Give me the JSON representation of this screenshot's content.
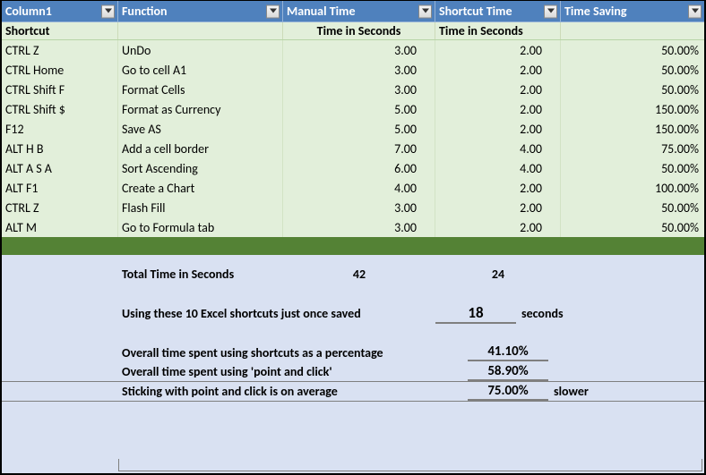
{
  "headers": {
    "col1": "Column1",
    "col2": "Function",
    "col3": "Manual Time",
    "col4": "Shortcut Time",
    "col5": "Time Saving"
  },
  "subheader": {
    "col1": "Shortcut",
    "col3": "Time in Seconds",
    "col4": "Time in Seconds"
  },
  "rows": [
    {
      "shortcut": "CTRL Z",
      "func": "UnDo",
      "manual": "3.00",
      "short": "2.00",
      "save": "50.00%"
    },
    {
      "shortcut": "CTRL Home",
      "func": "Go to cell A1",
      "manual": "3.00",
      "short": "2.00",
      "save": "50.00%"
    },
    {
      "shortcut": "CTRL Shift F",
      "func": "Format Cells",
      "manual": "3.00",
      "short": "2.00",
      "save": "50.00%"
    },
    {
      "shortcut": "CTRL Shift $",
      "func": "Format as Currency",
      "manual": "5.00",
      "short": "2.00",
      "save": "150.00%"
    },
    {
      "shortcut": "F12",
      "func": "Save AS",
      "manual": "5.00",
      "short": "2.00",
      "save": "150.00%"
    },
    {
      "shortcut": "ALT H B",
      "func": "Add a cell border",
      "manual": "7.00",
      "short": "4.00",
      "save": "75.00%"
    },
    {
      "shortcut": "ALT A S A",
      "func": "Sort Ascending",
      "manual": "6.00",
      "short": "4.00",
      "save": "50.00%"
    },
    {
      "shortcut": "ALT F1",
      "func": "Create a Chart",
      "manual": "4.00",
      "short": "2.00",
      "save": "100.00%"
    },
    {
      "shortcut": "CTRL Z",
      "func": "Flash Fill",
      "manual": "3.00",
      "short": "2.00",
      "save": "50.00%"
    },
    {
      "shortcut": "ALT M",
      "func": "Go to Formula tab",
      "manual": "3.00",
      "short": "2.00",
      "save": "50.00%"
    }
  ],
  "summary": {
    "total_label": "Total Time in Seconds",
    "total_manual": "42",
    "total_short": "24",
    "saved_label": "Using these 10 Excel shortcuts just once saved",
    "saved_value": "18",
    "saved_unit": "seconds",
    "shortcuts_pct_label": "Overall time spent using shortcuts as a percentage",
    "shortcuts_pct": "41.10%",
    "pointclick_pct_label": "Overall time spent using 'point and click'",
    "pointclick_pct": "58.90%",
    "slower_label": "Sticking with point and click is on average",
    "slower_pct": "75.00%",
    "slower_unit": "slower"
  }
}
